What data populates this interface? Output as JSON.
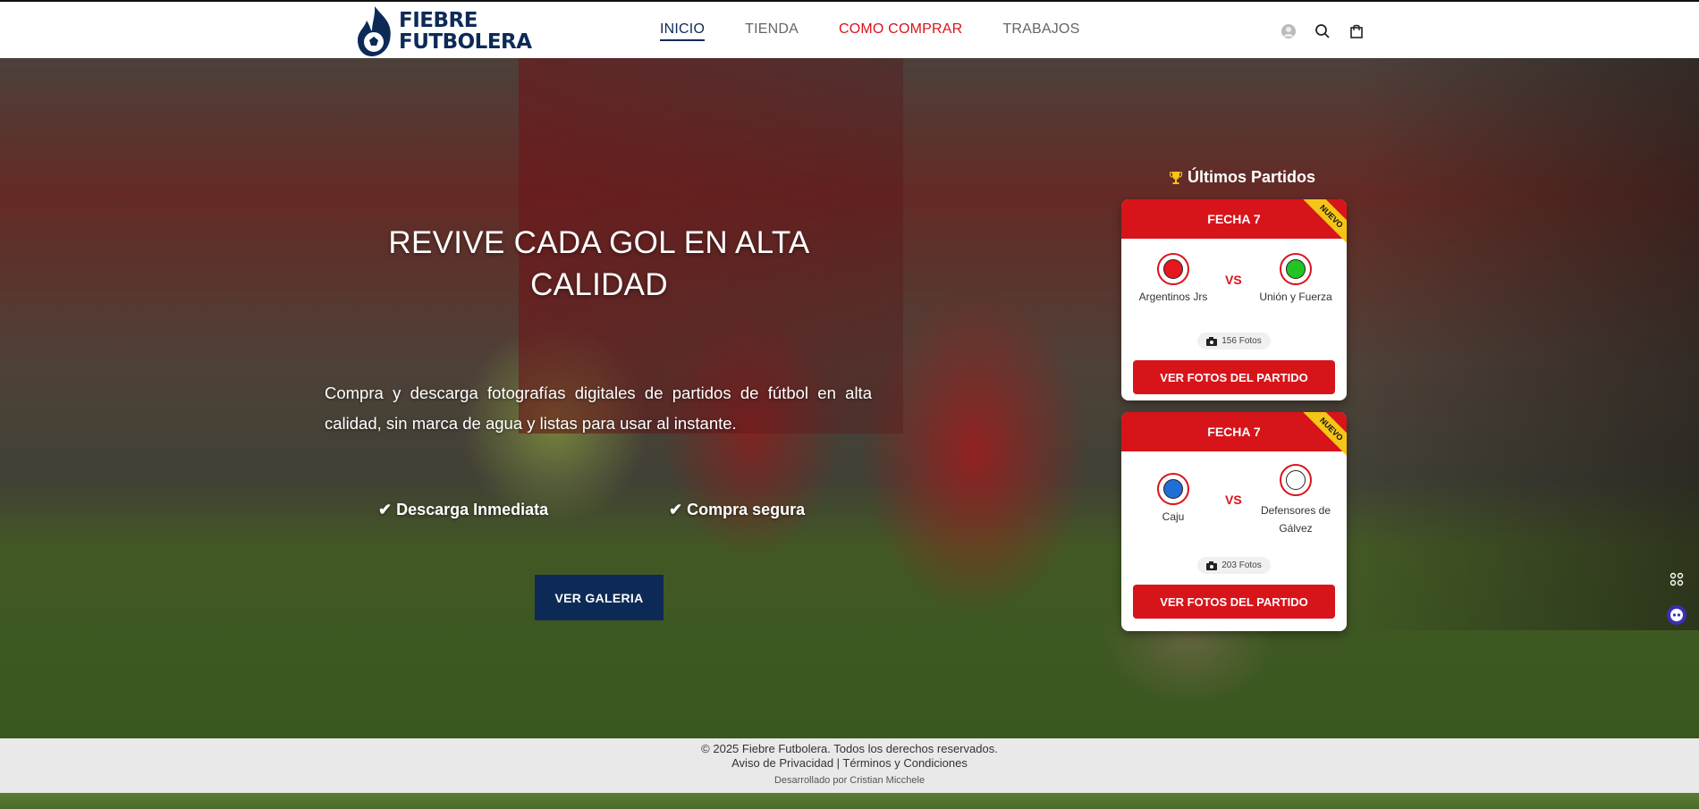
{
  "brand": {
    "line1": "FIEBRE",
    "line2": "FUTBOLERA"
  },
  "nav": {
    "items": [
      {
        "label": "INICIO"
      },
      {
        "label": "TIENDA"
      },
      {
        "label": "COMO COMPRAR"
      },
      {
        "label": "TRABAJOS"
      }
    ]
  },
  "header_icons": [
    "user-icon",
    "search-icon",
    "cart-icon"
  ],
  "hero": {
    "title": "REVIVE CADA GOL EN ALTA CALIDAD",
    "description": "Compra y descarga fotografías digitales de partidos de fútbol en alta calidad, sin marca de agua y listas para usar al instante.",
    "feature1": "✔ Descarga Inmediata",
    "feature2": "✔ Compra segura",
    "button": "VER GALERIA"
  },
  "matches": {
    "title": "Últimos Partidos",
    "cards": [
      {
        "round": "FECHA 7",
        "badge": "NUEVO",
        "home": "Argentinos Jrs",
        "home_color": "#e8161e",
        "away": "Unión y Fuerza",
        "away_color": "#22c322",
        "vs": "VS",
        "photos": "156 Fotos",
        "button": "VER FOTOS DEL PARTIDO"
      },
      {
        "round": "FECHA 7",
        "badge": "NUEVO",
        "home": "Caju",
        "home_color": "#1f6fd6",
        "away": "Defensores de Gálvez",
        "away_color": "#ffffff",
        "vs": "VS",
        "photos": "203 Fotos",
        "button": "VER FOTOS DEL PARTIDO"
      }
    ]
  },
  "side_icons": [
    "grid-icon",
    "chat-bot-icon"
  ],
  "footer": {
    "copyright": "© 2025 Fiebre Futbolera. Todos los derechos reservados.",
    "legal": "Aviso de Privacidad | Términos y Condiciones",
    "credit": "Desarrollado por Cristian Micchele"
  },
  "colors": {
    "brand_navy": "#0d2a57",
    "accent_red": "#d7141a",
    "badge_yellow": "#f5c518"
  }
}
